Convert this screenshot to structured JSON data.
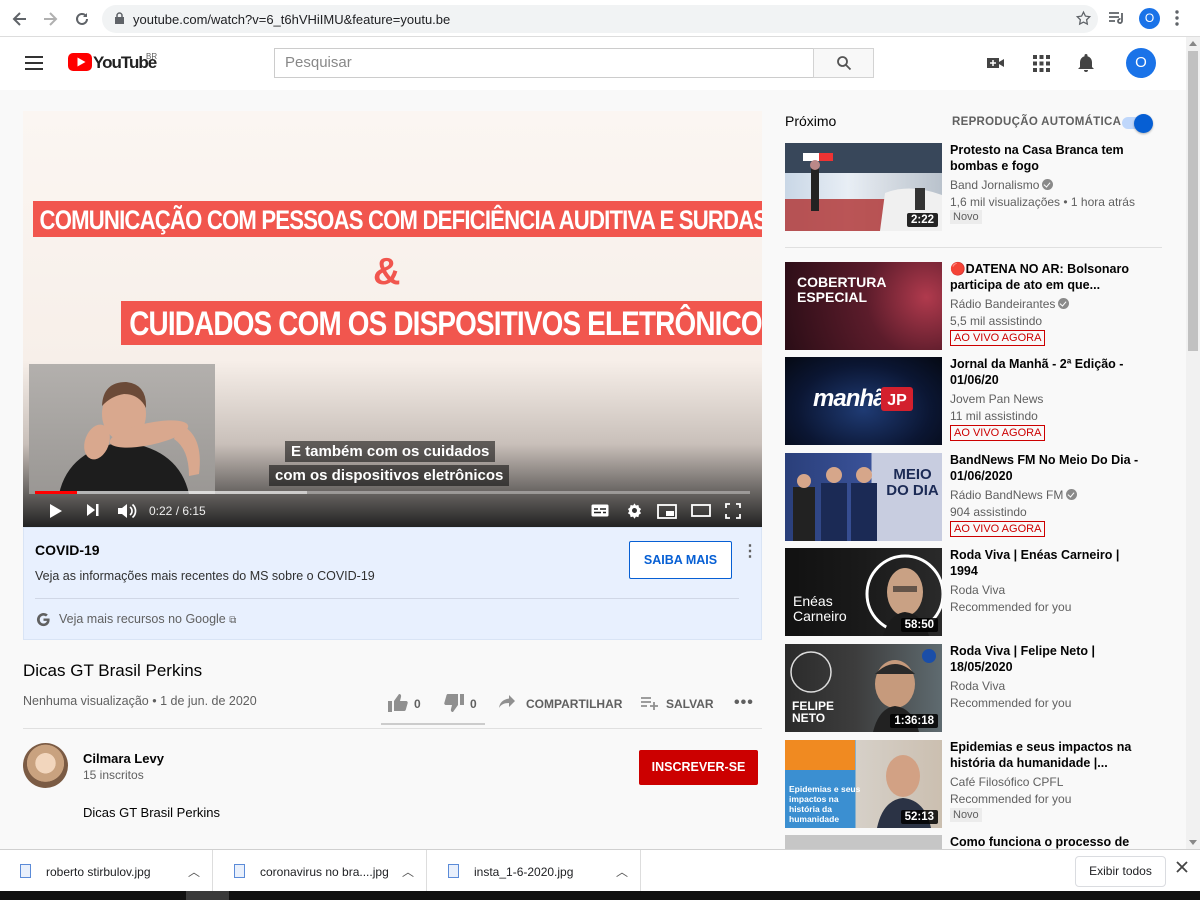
{
  "browser": {
    "url": "youtube.com/watch?v=6_t6hVHiIMU&feature=youtu.be",
    "profile_initial": "O"
  },
  "header": {
    "logo_text": "YouTube",
    "country": "BR",
    "search_placeholder": "Pesquisar",
    "avatar_initial": "O"
  },
  "player": {
    "banner1": "COMUNICAÇÃO COM PESSOAS COM DEFICIÊNCIA AUDITIVA E SURDAS E SURDOCEGOS",
    "amp": "&",
    "banner2": "CUIDADOS COM OS DISPOSITIVOS ELETRÔNICOS",
    "subtitle_line1": "E também com os cuidados",
    "subtitle_line2": "com os dispositivos eletrônicos",
    "time": "0:22 / 6:15",
    "progress": 0.059,
    "buffered": 0.38
  },
  "covid": {
    "title": "COVID-19",
    "description": "Veja as informações mais recentes do MS sobre o COVID-19",
    "button": "SAIBA MAIS",
    "google_link": "Veja mais recursos no Google"
  },
  "video": {
    "title": "Dicas GT Brasil Perkins",
    "meta": "Nenhuma visualização • 1 de jun. de 2020",
    "likes": "0",
    "dislikes": "0",
    "share": "COMPARTILHAR",
    "save": "SALVAR",
    "more": "•••"
  },
  "channel": {
    "name": "Cilmara Levy",
    "subs": "15 inscritos",
    "subscribe": "INSCREVER-SE",
    "description": "Dicas GT Brasil Perkins"
  },
  "sidebar": {
    "up_next": "Próximo",
    "autoplay": "REPRODUÇÃO AUTOMÁTICA",
    "autoplay_on": true,
    "items": [
      {
        "title": "Protesto na Casa Branca tem bombas e fogo",
        "channel": "Band Jornalismo",
        "verified": true,
        "stats": "1,6 mil visualizações • 1 hora atrás",
        "badge": "Novo",
        "duration": "2:22"
      },
      {
        "title": "🔴DATENA NO AR: Bolsonaro participa de ato em que...",
        "channel": "Rádio Bandeirantes",
        "verified": true,
        "stats": "5,5 mil assistindo",
        "badge": "AO VIVO AGORA",
        "thumb_text": "COBERTURA ESPECIAL"
      },
      {
        "title": "Jornal da Manhã - 2ª Edição - 01/06/20",
        "channel": "Jovem Pan News",
        "verified": false,
        "stats": "11 mil assistindo",
        "badge": "AO VIVO AGORA",
        "thumb_text": "manhã"
      },
      {
        "title": "BandNews FM No Meio Do Dia - 01/06/2020",
        "channel": "Rádio BandNews FM",
        "verified": true,
        "stats": "904 assistindo",
        "badge": "AO VIVO AGORA",
        "thumb_text": "MEIO DO DIA"
      },
      {
        "title": "Roda Viva | Enéas Carneiro | 1994",
        "channel": "Roda Viva",
        "verified": false,
        "stats": "Recommended for you",
        "duration": "58:50",
        "thumb_text": "Enéas Carneiro"
      },
      {
        "title": "Roda Viva | Felipe Neto | 18/05/2020",
        "channel": "Roda Viva",
        "verified": false,
        "stats": "Recommended for you",
        "duration": "1:36:18",
        "thumb_text": "FELIPE NETO"
      },
      {
        "title": "Epidemias e seus impactos na história da humanidade |...",
        "channel": "Café Filosófico CPFL",
        "verified": false,
        "stats": "Recommended for you",
        "badge": "Novo",
        "duration": "52:13",
        "thumb_text": "Epidemias e seus impactos na história da humanidade"
      },
      {
        "title": "Como funciona o processo de"
      }
    ]
  },
  "downloads": {
    "items": [
      "roberto stirbulov.jpg",
      "coronavirus no bra....jpg",
      "insta_1-6-2020.jpg"
    ],
    "show_all": "Exibir todos"
  },
  "colors": {
    "accent": "#065fd4",
    "red": "#cc0000",
    "banner": "#f1564e"
  }
}
